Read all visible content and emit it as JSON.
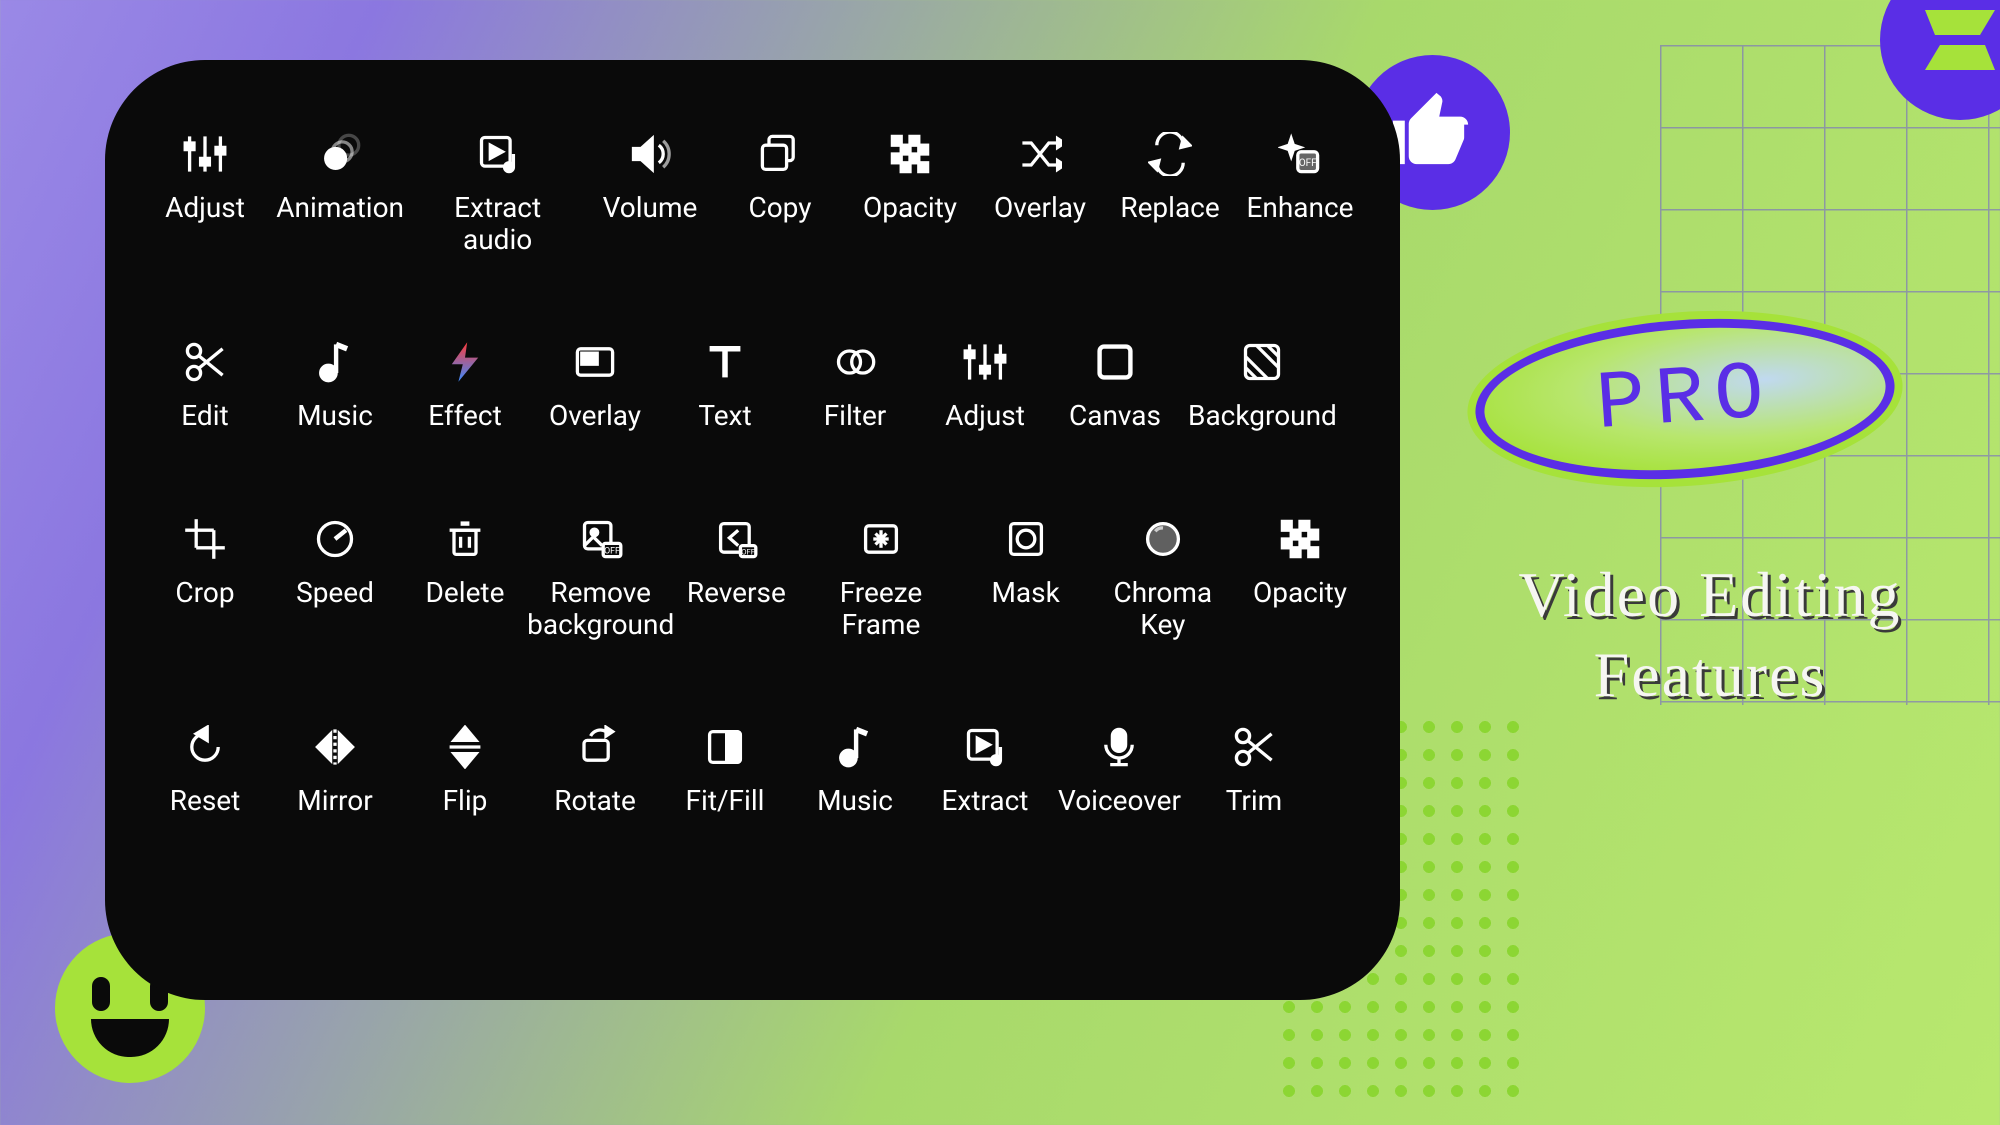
{
  "badge": {
    "semantic": "thumbs-up"
  },
  "corner": {
    "semantic": "logo"
  },
  "badgeText": "PRO",
  "heading": "Video Editing\nFeatures",
  "colors": {
    "accentPurple": "#5a2ee6",
    "accentGreen": "#a6e23a",
    "panelBg": "#0a0a0a"
  },
  "panel": {
    "rows": [
      [
        {
          "id": "adjust",
          "label": "Adjust",
          "icon": "sliders"
        },
        {
          "id": "animation",
          "label": "Animation",
          "icon": "ripple"
        },
        {
          "id": "extract-audio",
          "label": "Extract audio",
          "icon": "playnote"
        },
        {
          "id": "volume",
          "label": "Volume",
          "icon": "speaker"
        },
        {
          "id": "copy",
          "label": "Copy",
          "icon": "copy"
        },
        {
          "id": "opacity",
          "label": "Opacity",
          "icon": "checker"
        },
        {
          "id": "overlay",
          "label": "Overlay",
          "icon": "shuffle"
        },
        {
          "id": "replace",
          "label": "Replace",
          "icon": "swap"
        },
        {
          "id": "enhance",
          "label": "Enhance",
          "icon": "sparkleOff"
        }
      ],
      [
        {
          "id": "edit",
          "label": "Edit",
          "icon": "scissors"
        },
        {
          "id": "music",
          "label": "Music",
          "icon": "note"
        },
        {
          "id": "effect",
          "label": "Effect",
          "icon": "boltColor"
        },
        {
          "id": "overlay2",
          "label": "Overlay",
          "icon": "pip"
        },
        {
          "id": "text",
          "label": "Text",
          "icon": "text"
        },
        {
          "id": "filter",
          "label": "Filter",
          "icon": "loops"
        },
        {
          "id": "adjust2",
          "label": "Adjust",
          "icon": "sliders"
        },
        {
          "id": "canvas",
          "label": "Canvas",
          "icon": "square"
        },
        {
          "id": "background",
          "label": "Background",
          "icon": "hatch"
        }
      ],
      [
        {
          "id": "crop",
          "label": "Crop",
          "icon": "crop"
        },
        {
          "id": "speed",
          "label": "Speed",
          "icon": "gauge"
        },
        {
          "id": "delete",
          "label": "Delete",
          "icon": "trash"
        },
        {
          "id": "remove-bg",
          "label": "Remove\nbackground",
          "icon": "removebg"
        },
        {
          "id": "reverse",
          "label": "Reverse",
          "icon": "backarrowOff"
        },
        {
          "id": "freeze",
          "label": "Freeze Frame",
          "icon": "freeze"
        },
        {
          "id": "mask",
          "label": "Mask",
          "icon": "maskcircle"
        },
        {
          "id": "chroma",
          "label": "Chroma Key",
          "icon": "colorball"
        },
        {
          "id": "opacity2",
          "label": "Opacity",
          "icon": "checker"
        }
      ],
      [
        {
          "id": "reset",
          "label": "Reset",
          "icon": "undo"
        },
        {
          "id": "mirror",
          "label": "Mirror",
          "icon": "mirror"
        },
        {
          "id": "flip",
          "label": "Flip",
          "icon": "flipv"
        },
        {
          "id": "rotate",
          "label": "Rotate",
          "icon": "rotate"
        },
        {
          "id": "fitfill",
          "label": "Fit/Fill",
          "icon": "fitfill"
        },
        {
          "id": "music2",
          "label": "Music",
          "icon": "note"
        },
        {
          "id": "extract",
          "label": "Extract",
          "icon": "playnote"
        },
        {
          "id": "voiceover",
          "label": "Voiceover",
          "icon": "mic"
        },
        {
          "id": "trim",
          "label": "Trim",
          "icon": "scissors"
        }
      ]
    ]
  }
}
